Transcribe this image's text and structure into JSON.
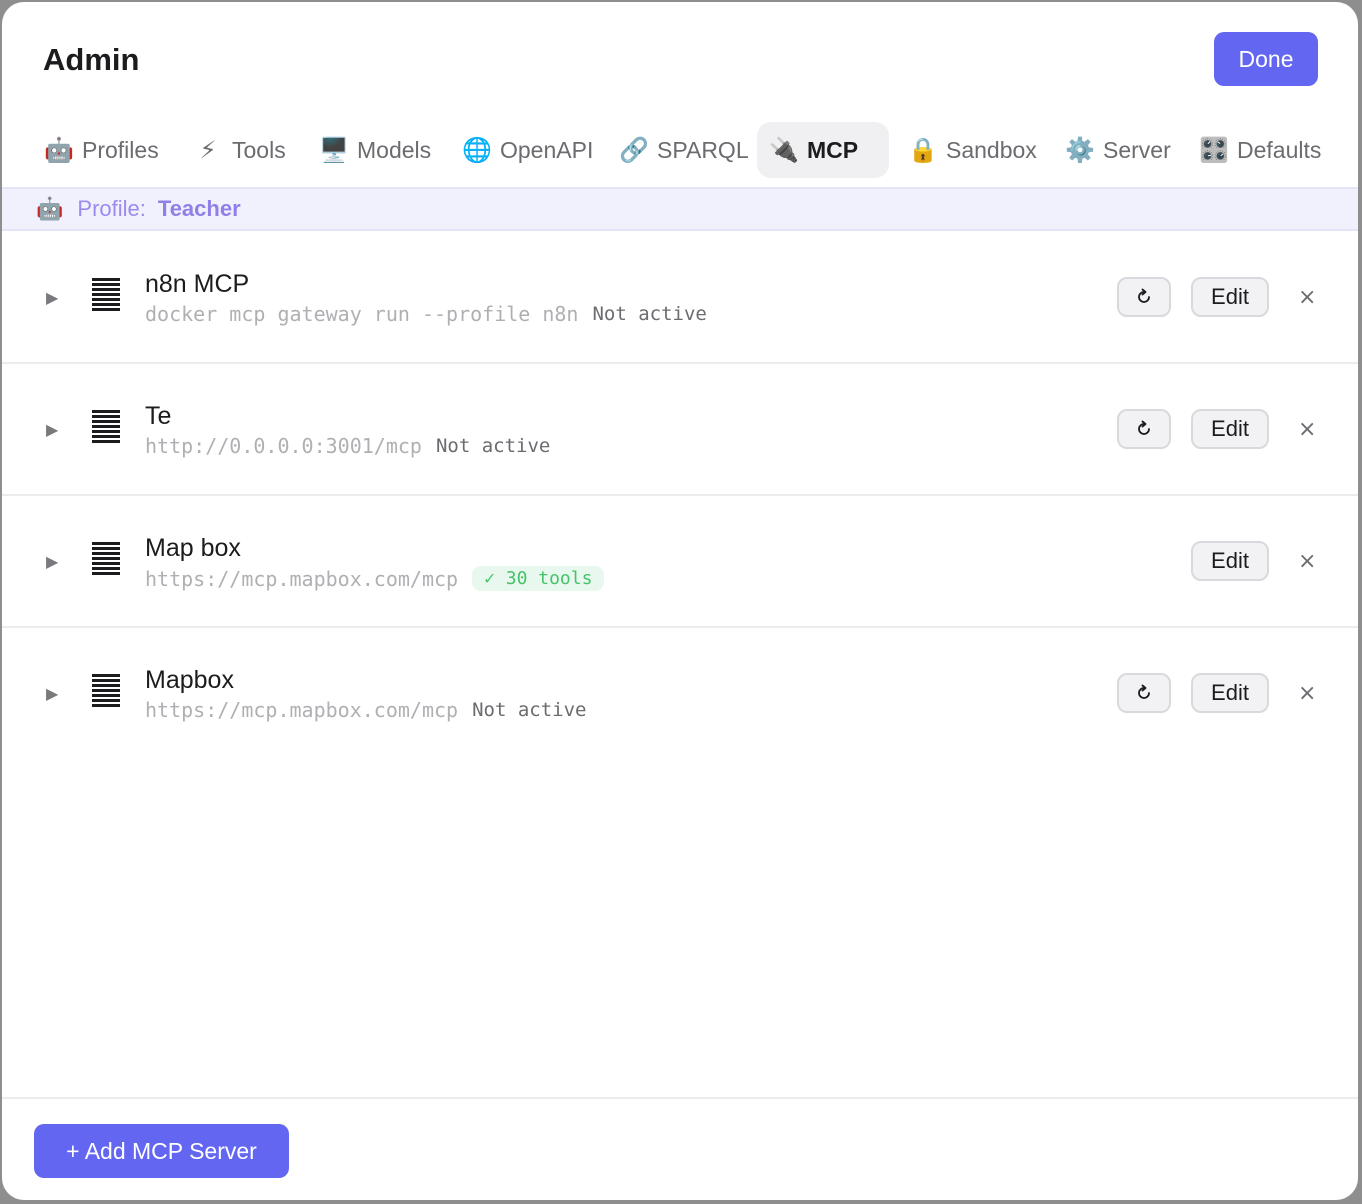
{
  "header": {
    "title": "Admin",
    "done_label": "Done"
  },
  "tabs": [
    {
      "icon": "🤖",
      "label": "Profiles",
      "active": false
    },
    {
      "icon": "⚡",
      "label": "Tools",
      "active": false
    },
    {
      "icon": "🖥️",
      "label": "Models",
      "active": false
    },
    {
      "icon": "🌐",
      "label": "OpenAPI",
      "active": false
    },
    {
      "icon": "🔗",
      "label": "SPARQL",
      "active": false
    },
    {
      "icon": "🔌",
      "label": "MCP",
      "active": true
    },
    {
      "icon": "🔒",
      "label": "Sandbox",
      "active": false
    },
    {
      "icon": "⚙️",
      "label": "Server",
      "active": false
    },
    {
      "icon": "🎛️",
      "label": "Defaults",
      "active": false
    }
  ],
  "profile": {
    "icon": "🤖",
    "label": "Profile:",
    "name": "Teacher"
  },
  "servers": [
    {
      "name": "n8n MCP",
      "command": "docker mcp gateway run --profile n8n",
      "status": "Not active",
      "badge": "",
      "refresh": true
    },
    {
      "name": "Te",
      "command": "http://0.0.0.0:3001/mcp",
      "status": "Not active",
      "badge": "",
      "refresh": true
    },
    {
      "name": "Map box",
      "command": "https://mcp.mapbox.com/mcp",
      "status": "",
      "badge": "✓ 30 tools",
      "refresh": false
    },
    {
      "name": "Mapbox",
      "command": "https://mcp.mapbox.com/mcp",
      "status": "Not active",
      "badge": "",
      "refresh": true
    }
  ],
  "row_actions": {
    "edit_label": "Edit",
    "remove_symbol": "×"
  },
  "footer": {
    "add_label": "+ Add MCP Server"
  },
  "colors": {
    "accent": "#6366f1",
    "profile_tint": "#f1f1fd",
    "success": "#44c46a"
  }
}
